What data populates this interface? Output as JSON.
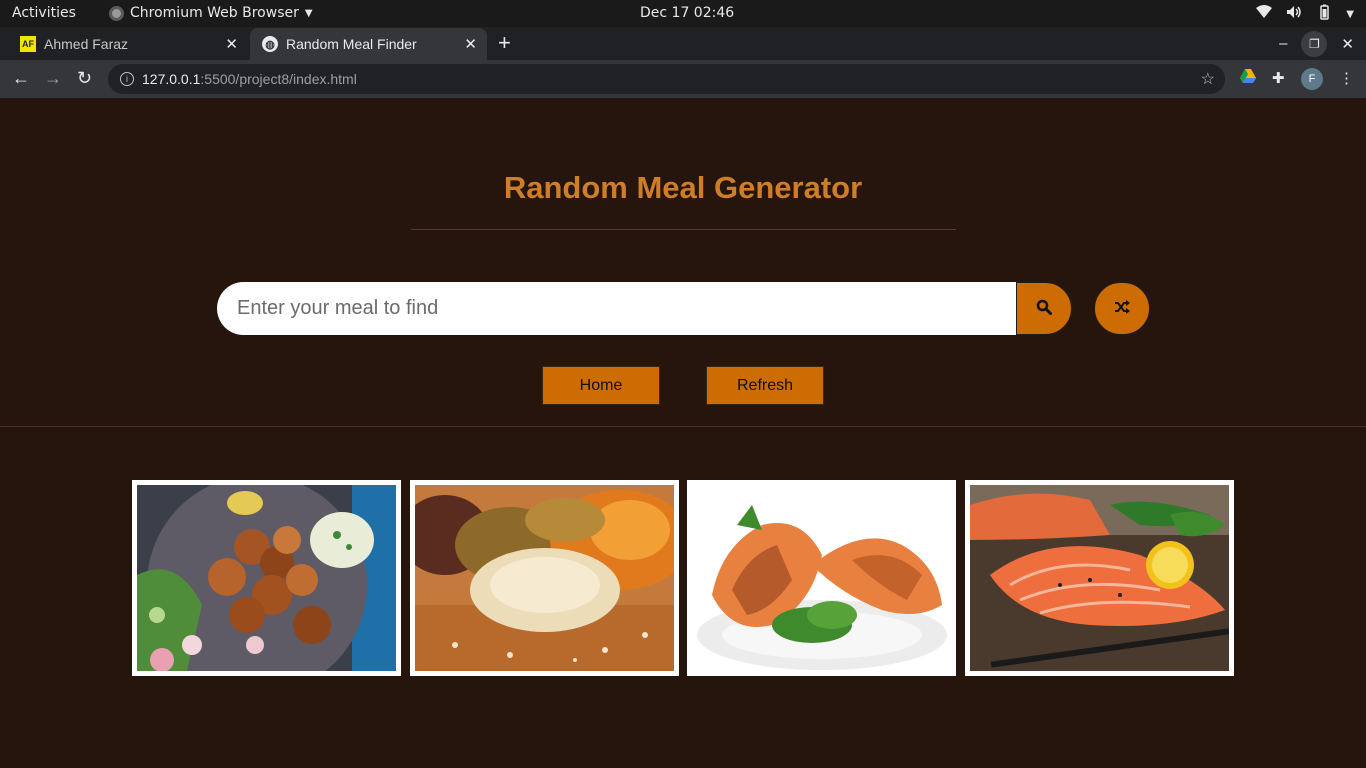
{
  "os_bar": {
    "activities": "Activities",
    "app_name": "Chromium Web Browser",
    "clock": "Dec 17  02:46"
  },
  "browser": {
    "tabs": [
      {
        "title": "Ahmed Faraz",
        "favicon": "AF",
        "active": false
      },
      {
        "title": "Random Meal Finder",
        "favicon": "globe-icon",
        "active": true
      }
    ],
    "url_host": "127.0.0.1",
    "url_path": ":5500/project8/index.html",
    "profile_initial": "F"
  },
  "page": {
    "title": "Random Meal Generator",
    "search": {
      "placeholder": "Enter your meal to find",
      "value": ""
    },
    "buttons": {
      "home": "Home",
      "refresh": "Refresh"
    },
    "meals": [
      {
        "name": "meal-image-chicken-skewers",
        "icon": "chicken-kebab-salad"
      },
      {
        "name": "meal-image-grains",
        "icon": "grains-and-seeds"
      },
      {
        "name": "meal-image-grilled-salmon",
        "icon": "grilled-salmon-plate"
      },
      {
        "name": "meal-image-raw-salmon",
        "icon": "raw-salmon-lemon"
      }
    ]
  },
  "colors": {
    "background": "#25150c",
    "accent": "#cc6c02",
    "title": "#cf7d26"
  }
}
